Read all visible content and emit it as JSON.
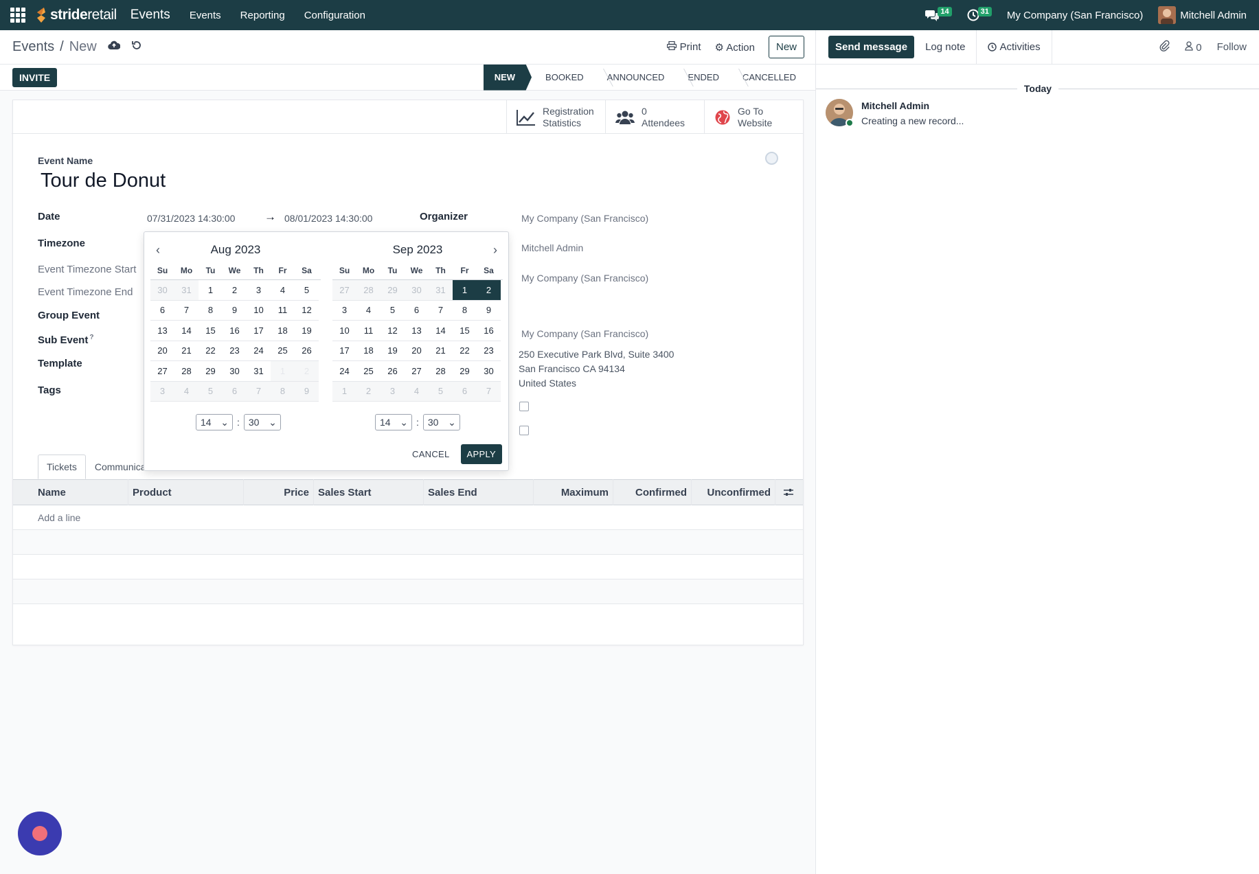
{
  "navbar": {
    "brand_a": "stride",
    "brand_b": "retail",
    "app_title": "Events",
    "menu": [
      "Events",
      "Reporting",
      "Configuration"
    ],
    "messages_count": "14",
    "activities_count": "31",
    "company": "My Company (San Francisco)",
    "user": "Mitchell Admin"
  },
  "control_panel": {
    "breadcrumb_parent": "Events",
    "breadcrumb_sep": "/",
    "breadcrumb_current": "New",
    "print_label": "Print",
    "action_label": "Action",
    "new_label": "New"
  },
  "statusbar": {
    "invite_label": "INVITE",
    "stages": [
      "NEW",
      "BOOKED",
      "ANNOUNCED",
      "ENDED",
      "CANCELLED"
    ],
    "active_stage": "NEW"
  },
  "smart_buttons": [
    {
      "line1": "Registration",
      "line2": "Statistics",
      "icon": "chart-line-icon"
    },
    {
      "line1": "0",
      "line2": "Attendees",
      "icon": "users-icon"
    },
    {
      "line1": "Go To",
      "line2": "Website",
      "icon": "globe-icon"
    }
  ],
  "form": {
    "event_name_label": "Event Name",
    "event_name": "Tour de Donut",
    "date_label": "Date",
    "date_start": "07/31/2023 14:30:00",
    "date_arrow": "→",
    "date_end": "08/01/2023 14:30:00",
    "organizer_label": "Organizer",
    "organizer_value": "My Company (San Francisco)",
    "timezone_label": "Timezone",
    "responsible_value": "Mitchell Admin",
    "tz_start_label": "Event Timezone Start",
    "tz_end_label": "Event Timezone End",
    "company_value": "My Company (San Francisco)",
    "group_event_label": "Group Event",
    "sub_event_label": "Sub Event",
    "sub_event_help": "?",
    "venue_value": "My Company (San Francisco)",
    "address_line1": "250 Executive Park Blvd, Suite 3400",
    "address_line2": "San Francisco CA 94134",
    "address_line3": "United States",
    "template_label": "Template",
    "tags_label": "Tags"
  },
  "tabs": [
    "Tickets",
    "Communica"
  ],
  "tickets_table": {
    "columns": [
      "Name",
      "Product",
      "Price",
      "Sales Start",
      "Sales End",
      "Maximum",
      "Confirmed",
      "Unconfirmed"
    ],
    "add_line": "Add a line"
  },
  "datepicker": {
    "dow": [
      "Su",
      "Mo",
      "Tu",
      "We",
      "Th",
      "Fr",
      "Sa"
    ],
    "left_month": "Aug 2023",
    "right_month": "Sep 2023",
    "left_days": [
      [
        "30",
        "31",
        "1",
        "2",
        "3",
        "4",
        "5"
      ],
      [
        "6",
        "7",
        "8",
        "9",
        "10",
        "11",
        "12"
      ],
      [
        "13",
        "14",
        "15",
        "16",
        "17",
        "18",
        "19"
      ],
      [
        "20",
        "21",
        "22",
        "23",
        "24",
        "25",
        "26"
      ],
      [
        "27",
        "28",
        "29",
        "30",
        "31",
        "1",
        "2"
      ],
      [
        "3",
        "4",
        "5",
        "6",
        "7",
        "8",
        "9"
      ]
    ],
    "right_days": [
      [
        "27",
        "28",
        "29",
        "30",
        "31",
        "1",
        "2"
      ],
      [
        "3",
        "4",
        "5",
        "6",
        "7",
        "8",
        "9"
      ],
      [
        "10",
        "11",
        "12",
        "13",
        "14",
        "15",
        "16"
      ],
      [
        "17",
        "18",
        "19",
        "20",
        "21",
        "22",
        "23"
      ],
      [
        "24",
        "25",
        "26",
        "27",
        "28",
        "29",
        "30"
      ],
      [
        "1",
        "2",
        "3",
        "4",
        "5",
        "6",
        "7"
      ]
    ],
    "left_hour": "14",
    "left_minute": "30",
    "right_hour": "14",
    "right_minute": "30",
    "time_sep": ":",
    "cancel_label": "CANCEL",
    "apply_label": "APPLY"
  },
  "chatter": {
    "send_message": "Send message",
    "log_note": "Log note",
    "activities": "Activities",
    "followers_count": "0",
    "follow": "Follow",
    "today": "Today",
    "message_author": "Mitchell Admin",
    "message_body": "Creating a new record..."
  },
  "colors": {
    "primary": "#1c3d45",
    "badge": "#21a06a"
  }
}
